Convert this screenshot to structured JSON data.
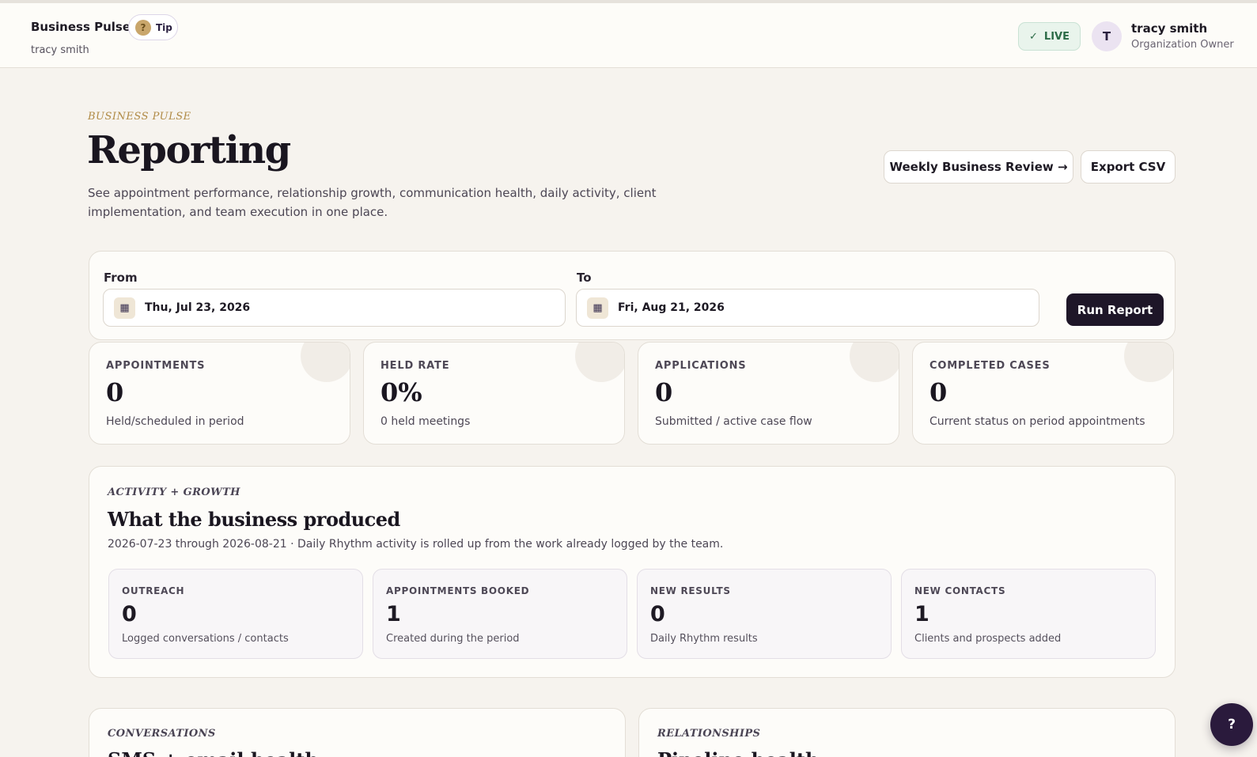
{
  "header": {
    "brand": "Business Pulse",
    "brand_user": "tracy smith",
    "tip_icon": "?",
    "tip_label": "Tip",
    "live_check": "✓",
    "live_label": "LIVE",
    "avatar_initial": "T",
    "user_name": "tracy smith",
    "user_role": "Organization Owner"
  },
  "page": {
    "eyebrow": "BUSINESS PULSE",
    "title": "Reporting",
    "description": "See appointment performance, relationship growth, communication health, daily activity, client implementation, and team execution in one place.",
    "weekly_review_label": "Weekly Business Review →",
    "export_label": "Export CSV"
  },
  "filters": {
    "from_label": "From",
    "from_value": "Thu, Jul 23, 2026",
    "to_label": "To",
    "to_value": "Fri, Aug 21, 2026",
    "calendar_icon": "▦",
    "run_label": "Run Report"
  },
  "metrics": [
    {
      "label": "APPOINTMENTS",
      "value": "0",
      "sub": "Held/scheduled in period"
    },
    {
      "label": "HELD RATE",
      "value": "0%",
      "sub": "0 held meetings"
    },
    {
      "label": "APPLICATIONS",
      "value": "0",
      "sub": "Submitted / active case flow"
    },
    {
      "label": "COMPLETED CASES",
      "value": "0",
      "sub": "Current status on period appointments"
    }
  ],
  "activity": {
    "eyebrow": "ACTIVITY + GROWTH",
    "title": "What the business produced",
    "description": "2026-07-23 through 2026-08-21 · Daily Rhythm activity is rolled up from the work already logged by the team.",
    "stats": [
      {
        "label": "OUTREACH",
        "value": "0",
        "sub": "Logged conversations / contacts"
      },
      {
        "label": "APPOINTMENTS BOOKED",
        "value": "1",
        "sub": "Created during the period"
      },
      {
        "label": "NEW RESULTS",
        "value": "0",
        "sub": "Daily Rhythm results"
      },
      {
        "label": "NEW CONTACTS",
        "value": "1",
        "sub": "Clients and prospects added"
      }
    ]
  },
  "sections": {
    "conversations_eyebrow": "CONVERSATIONS",
    "conversations_title": "SMS + email health",
    "relationships_eyebrow": "RELATIONSHIPS",
    "relationships_title": "Pipeline health"
  },
  "help": {
    "icon": "?"
  },
  "colors": {
    "background": "#f6f3ee",
    "accent_gold": "#b08a45",
    "primary_dark": "#1e1628",
    "live_green": "#2c6b47"
  }
}
